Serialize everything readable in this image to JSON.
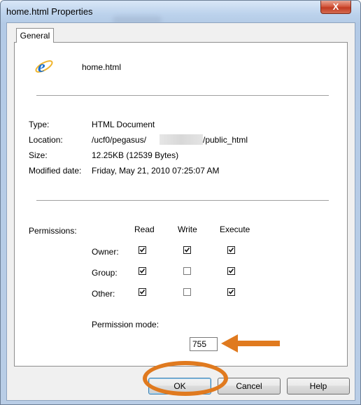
{
  "window": {
    "title": "home.html Properties",
    "close_glyph": "X"
  },
  "tabs": [
    {
      "label": "General"
    }
  ],
  "file": {
    "name": "home.html",
    "icon": "internet-explorer-icon"
  },
  "info": {
    "type_label": "Type:",
    "type_value": "HTML Document",
    "location_label": "Location:",
    "location_prefix": "/ucf0/pegasus/",
    "location_suffix": "/public_html",
    "size_label": "Size:",
    "size_value": "12.25KB (12539 Bytes)",
    "modified_label": "Modified date:",
    "modified_value": "Friday, May 21, 2010 07:25:07 AM"
  },
  "permissions": {
    "label": "Permissions:",
    "columns": [
      "Read",
      "Write",
      "Execute"
    ],
    "rows": [
      {
        "label": "Owner:",
        "read": true,
        "write": true,
        "execute": true
      },
      {
        "label": "Group:",
        "read": true,
        "write": false,
        "execute": true
      },
      {
        "label": "Other:",
        "read": true,
        "write": false,
        "execute": true
      }
    ],
    "mode_label": "Permission mode:",
    "mode_value": "755"
  },
  "buttons": {
    "ok": "OK",
    "cancel": "Cancel",
    "help": "Help"
  },
  "colors": {
    "annotation": "#e07a1f",
    "title_bar": "#bcd2ec",
    "close": "#c23b22"
  }
}
